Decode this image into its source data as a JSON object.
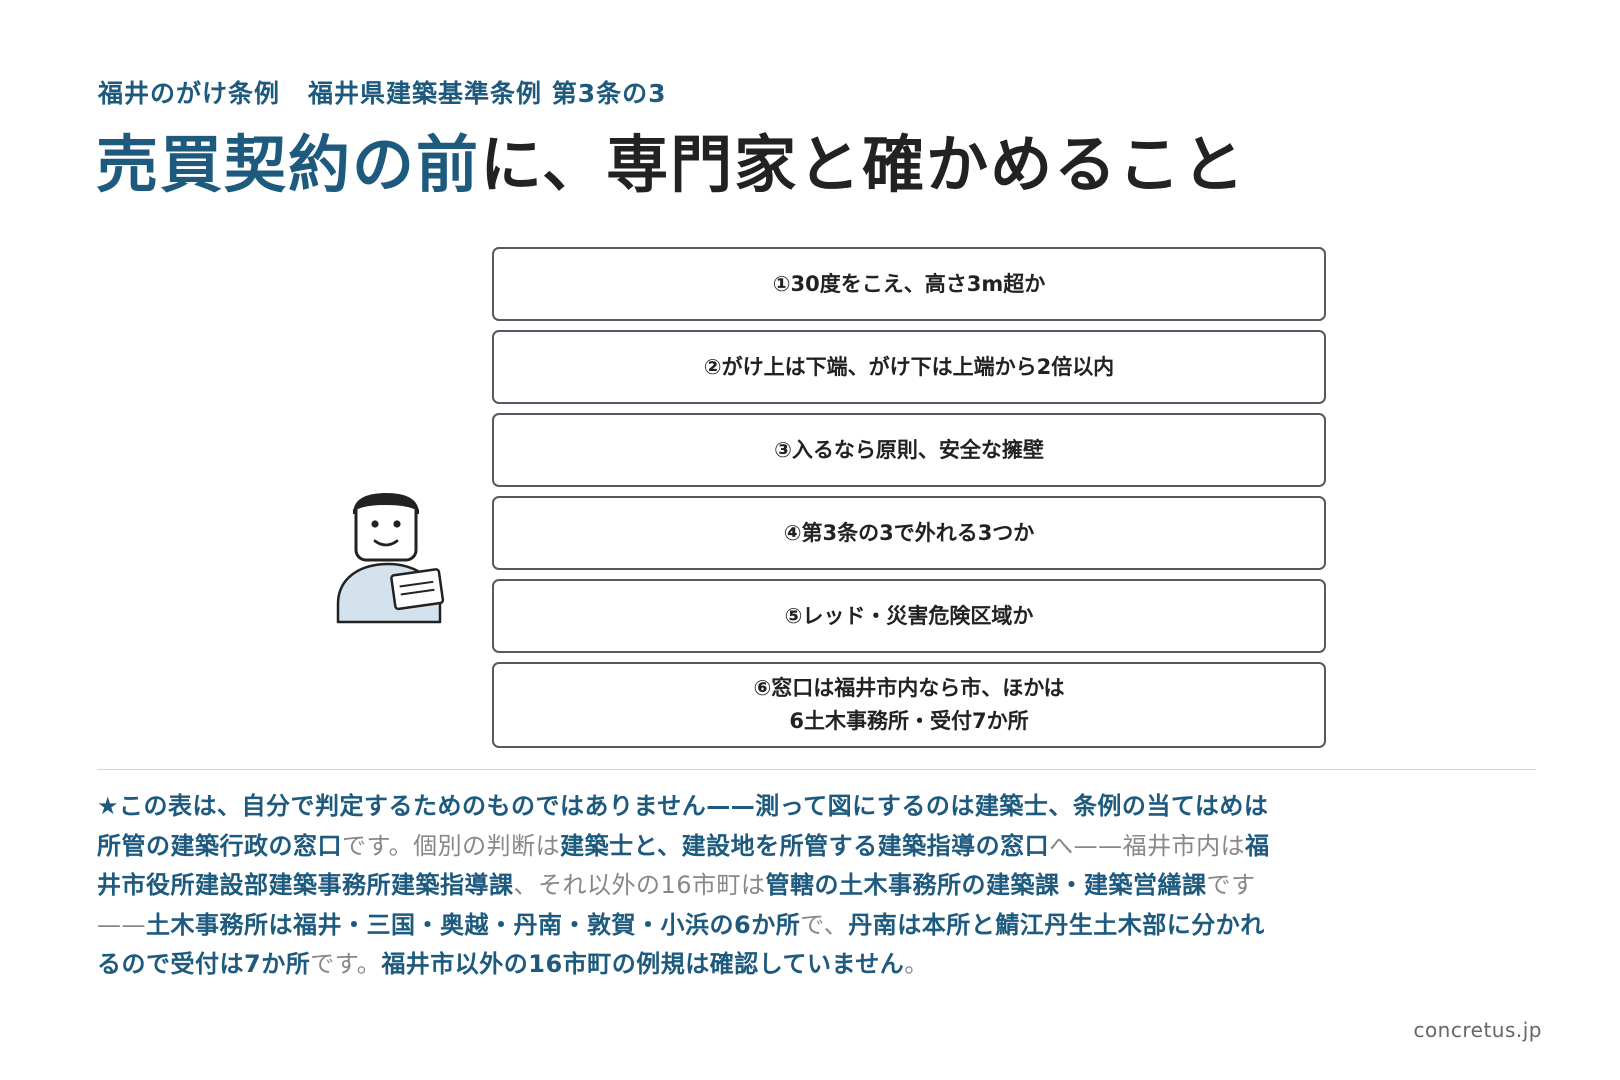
{
  "header": {
    "subtitle_part1": "福井のがけ条例",
    "subtitle_part2": "福井県建築基準条例 第3条の3",
    "title_accent": "売買契約の前",
    "title_rest": "に、専門家と確かめること"
  },
  "steps": [
    {
      "label": "①30度をこえ、高さ3m超か"
    },
    {
      "label": "②がけ上は下端、がけ下は上端から2倍以内"
    },
    {
      "label": "③入るなら原則、安全な擁壁"
    },
    {
      "label": "④第3条の3で外れる3つか"
    },
    {
      "label": "⑤レッド・災害危険区域か"
    },
    {
      "label": "⑥窓口は福井市内なら市、ほかは\n6土木事務所・受付7か所"
    }
  ],
  "note": {
    "segments": [
      {
        "text": "★この表は、自分で判定するためのものではありません——測って図にするのは建築士、条例の当てはめは所管の建築行政の窓口",
        "emphasis": true
      },
      {
        "text": "です。個別の判断は",
        "emphasis": false
      },
      {
        "text": "建築士と、建設地を所管する建築指導の窓口",
        "emphasis": true
      },
      {
        "text": "へ——福井市内は",
        "emphasis": false
      },
      {
        "text": "福井市役所建設部建築事務所建築指導課",
        "emphasis": true
      },
      {
        "text": "、それ以外の16市町は",
        "emphasis": false
      },
      {
        "text": "管轄の土木事務所の建築課・建築営繕課",
        "emphasis": true
      },
      {
        "text": "です——",
        "emphasis": false
      },
      {
        "text": "土木事務所は福井・三国・奥越・丹南・敦賀・小浜の6か所",
        "emphasis": true
      },
      {
        "text": "で、",
        "emphasis": false
      },
      {
        "text": "丹南は本所と鯖江丹生土木部に分かれるので受付は7か所",
        "emphasis": true
      },
      {
        "text": "です。",
        "emphasis": false
      },
      {
        "text": "福井市以外の16市町の例規は確認していません",
        "emphasis": true
      },
      {
        "text": "。",
        "emphasis": false
      }
    ]
  },
  "footer": {
    "source": "concretus.jp"
  },
  "colors": {
    "accent": "#1d5a7e",
    "text": "#222222",
    "muted": "#888888",
    "border": "#555a60"
  }
}
